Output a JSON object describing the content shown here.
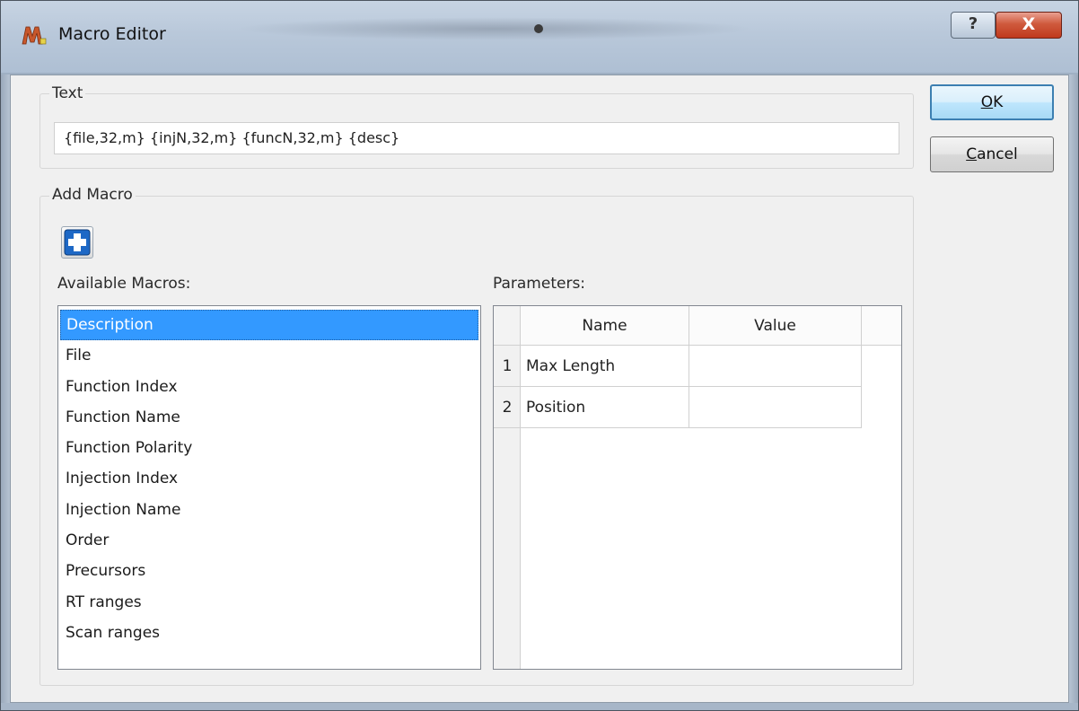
{
  "window": {
    "title": "Macro Editor",
    "help_label": "?",
    "close_label": "X"
  },
  "text_group": {
    "label": "Text",
    "value": "{file,32,m} {injN,32,m} {funcN,32,m} {desc}"
  },
  "buttons": {
    "ok": {
      "accel": "O",
      "rest": "K"
    },
    "cancel": {
      "accel": "C",
      "rest": "ancel"
    }
  },
  "add_macro": {
    "label": "Add Macro",
    "add_icon": "plus-icon",
    "available_label": "Available Macros:",
    "parameters_label": "Parameters:",
    "macros": [
      "Description",
      "File",
      "Function Index",
      "Function Name",
      "Function Polarity",
      "Injection Index",
      "Injection Name",
      "Order",
      "Precursors",
      "RT ranges",
      "Scan ranges"
    ],
    "selected_index": 0,
    "columns": [
      "Name",
      "Value"
    ],
    "rows": [
      {
        "num": "1",
        "name": "Max Length",
        "value": ""
      },
      {
        "num": "2",
        "name": "Position",
        "value": ""
      }
    ]
  },
  "colors": {
    "selection": "#3399ff",
    "default_button_border": "#3c7fb1",
    "close_button": "#c0391d",
    "add_icon_blue": "#1d68c6"
  }
}
